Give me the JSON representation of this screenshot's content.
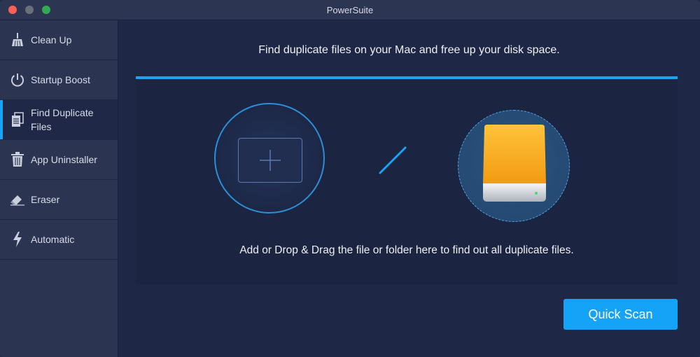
{
  "window": {
    "title": "PowerSuite"
  },
  "sidebar": {
    "items": [
      {
        "label": "Clean Up",
        "icon": "broom-icon",
        "active": false
      },
      {
        "label": "Startup Boost",
        "icon": "power-icon",
        "active": false
      },
      {
        "label": "Find Duplicate Files",
        "icon": "duplicate-files-icon",
        "active": true
      },
      {
        "label": "App Uninstaller",
        "icon": "trash-icon",
        "active": false
      },
      {
        "label": "Eraser",
        "icon": "eraser-icon",
        "active": false
      },
      {
        "label": "Automatic",
        "icon": "lightning-icon",
        "active": false
      }
    ]
  },
  "main": {
    "headline": "Find duplicate files on your Mac and free up your disk space.",
    "instructions": "Add or Drop & Drag the file or folder here to find out all duplicate files.",
    "quick_scan_label": "Quick Scan"
  },
  "colors": {
    "accent": "#1aa4f5",
    "background": "#1e2746",
    "sidebar": "#2b3552",
    "button": "#15a3f7",
    "drive_orange": "#f7a81b"
  }
}
